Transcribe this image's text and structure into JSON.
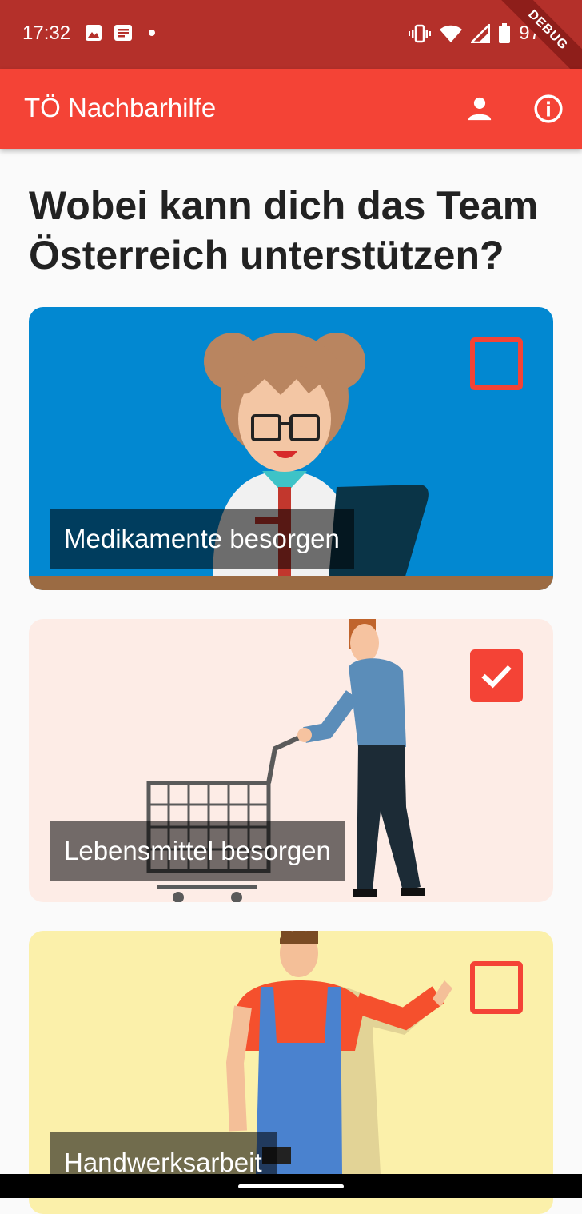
{
  "status_bar": {
    "time": "17:32",
    "battery": "97",
    "debug_banner": "DEBUG",
    "icons_left": [
      "image-icon",
      "notes-icon",
      "dot-icon"
    ],
    "icons_right": [
      "vibrate-icon",
      "wifi-icon",
      "signal-icon",
      "battery-icon"
    ]
  },
  "app_bar": {
    "title": "TÖ Nachbarhilfe",
    "actions": [
      "person-icon",
      "info-icon"
    ]
  },
  "heading": "Wobei kann dich das Team Österreich unterstützen?",
  "cards": [
    {
      "label": "Medikamente besorgen",
      "checked": false,
      "background": "#0288d1"
    },
    {
      "label": "Lebensmittel besorgen",
      "checked": true,
      "background": "#fdece6"
    },
    {
      "label": "Handwerksarbeit",
      "checked": false,
      "background": "#fbf0aa"
    }
  ],
  "colors": {
    "accent": "#f44336",
    "status_bar": "#b4302a"
  }
}
